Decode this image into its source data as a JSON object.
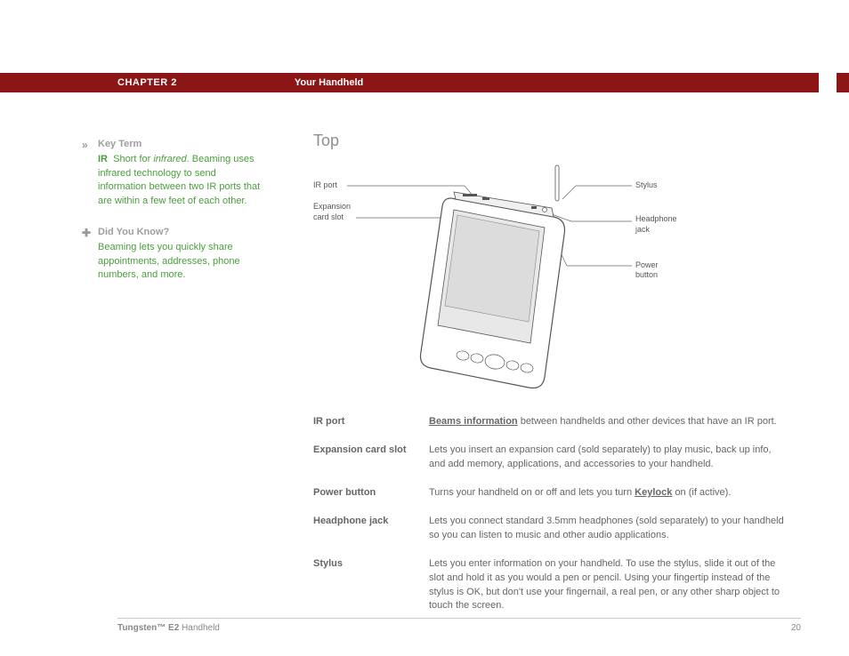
{
  "header": {
    "chapter": "CHAPTER 2",
    "title": "Your Handheld"
  },
  "sidebar": {
    "keyterm": {
      "icon": "»",
      "head": "Key Term",
      "term": "IR",
      "body": "Short for infrared. Beaming uses infrared technology to send information between two IR ports that are within a few feet of each other."
    },
    "dyk": {
      "icon": "✚",
      "head": "Did You Know?",
      "body": "Beaming lets you quickly share appointments, addresses, phone numbers, and more."
    }
  },
  "section_title": "Top",
  "diagram_labels": {
    "ir_port": "IR port",
    "exp_slot_l1": "Expansion",
    "exp_slot_l2": "card slot",
    "stylus": "Stylus",
    "headphone_l1": "Headphone",
    "headphone_l2": "jack",
    "power": "Power button"
  },
  "defs": [
    {
      "term": "IR port",
      "link": "Beams information",
      "rest": " between handhelds and other devices that have an IR port."
    },
    {
      "term": "Expansion card slot",
      "link": "",
      "rest": "Lets you insert an expansion card (sold separately) to play music, back up info, and add memory, applications, and accessories to your handheld."
    },
    {
      "term": "Power button",
      "link": "Keylock",
      "rest_pre": "Turns your handheld on or off and lets you turn ",
      "rest_post": " on (if active)."
    },
    {
      "term": "Headphone jack",
      "link": "",
      "rest": "Lets you connect standard 3.5mm headphones (sold separately) to your handheld so you can listen to music and other audio applications."
    },
    {
      "term": "Stylus",
      "link": "",
      "rest": "Lets you enter information on your handheld. To use the stylus, slide it out of the slot and hold it as you would a pen or pencil. Using your fingertip instead of the stylus is OK, but don't use your fingernail, a real pen, or any other sharp object to touch the screen."
    }
  ],
  "footer": {
    "product_bold": "Tungsten™ E2",
    "product_rest": " Handheld",
    "page": "20"
  }
}
